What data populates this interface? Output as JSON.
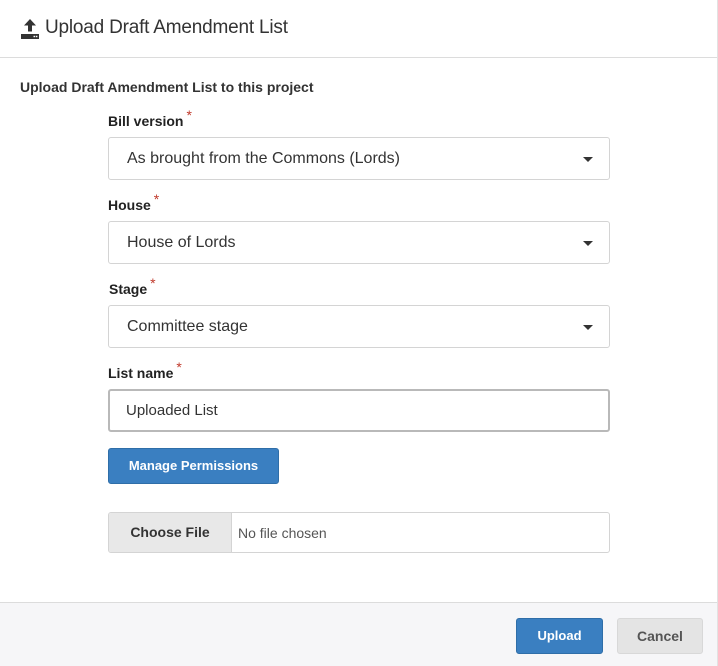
{
  "header": {
    "icon": "upload-icon",
    "title": "Upload Draft Amendment List"
  },
  "intro_text": "Upload Draft Amendment List to this project",
  "required_marker": "*",
  "form": {
    "bill_version": {
      "label": "Bill version",
      "value": "As brought from the Commons (Lords)"
    },
    "house": {
      "label": "House",
      "value": "House of Lords"
    },
    "stage": {
      "label": "Stage",
      "value": "Committee stage"
    },
    "list_name": {
      "label": "List name",
      "value": "Uploaded List"
    },
    "manage_permissions_label": "Manage Permissions",
    "file": {
      "button_label": "Choose File",
      "status": "No file chosen"
    }
  },
  "footer": {
    "upload_label": "Upload",
    "cancel_label": "Cancel"
  },
  "colors": {
    "primary": "#3a7fc1",
    "required": "#c0392b",
    "footer_bg": "#f6f6f8"
  }
}
